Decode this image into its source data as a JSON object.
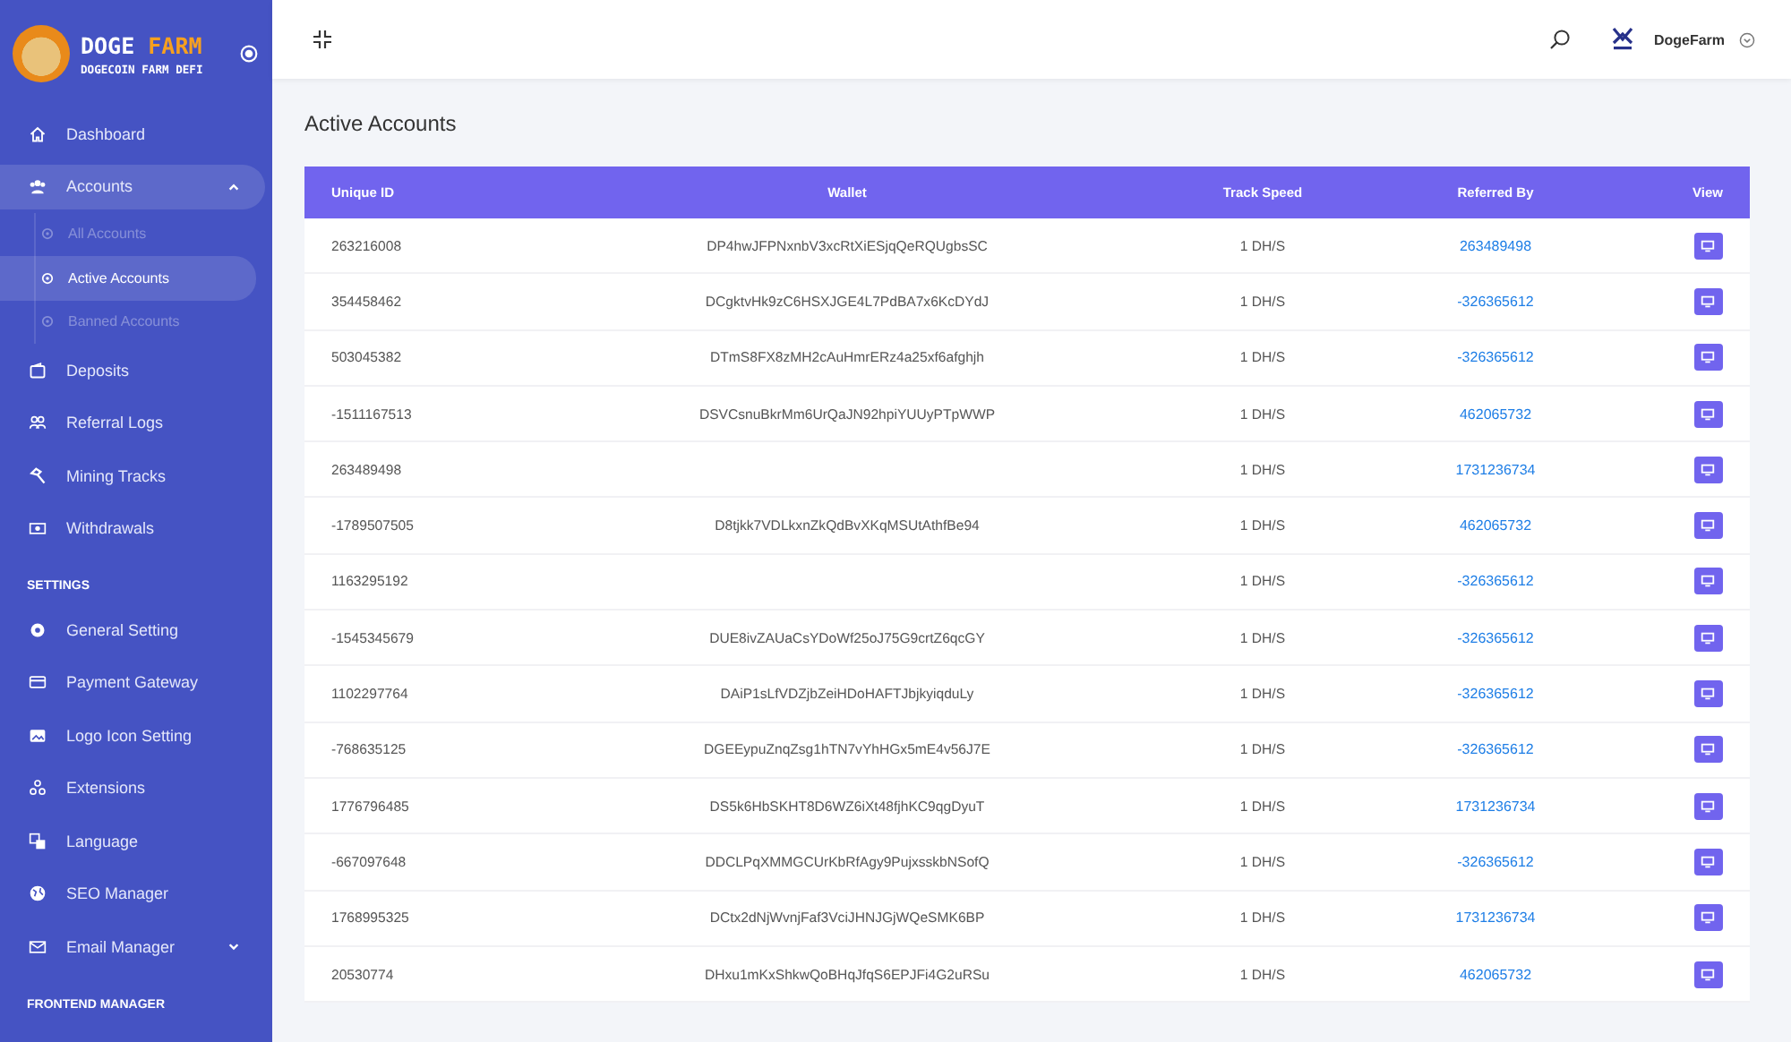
{
  "sidebar": {
    "brand": {
      "words": [
        "DOGE",
        "FARM"
      ],
      "tagline": "DOGECOIN FARM DEFI"
    },
    "sections": [
      {
        "items": [
          {
            "label": "Dashboard",
            "selected": false
          },
          {
            "label": "Accounts",
            "selected": false,
            "expanded": true,
            "children": [
              {
                "label": "All Accounts",
                "selected": false
              },
              {
                "label": "Active Accounts",
                "selected": true
              },
              {
                "label": "Banned Accounts",
                "selected": false
              }
            ]
          },
          {
            "label": "Deposits",
            "selected": false
          },
          {
            "label": "Referral Logs",
            "selected": false
          },
          {
            "label": "Mining Tracks",
            "selected": false
          },
          {
            "label": "Withdrawals",
            "selected": false
          }
        ]
      },
      {
        "heading": "SETTINGS",
        "items": [
          {
            "label": "General Setting",
            "selected": false
          },
          {
            "label": "Payment Gateway",
            "selected": false
          },
          {
            "label": "Logo Icon Setting",
            "selected": false
          },
          {
            "label": "Extensions",
            "selected": false
          },
          {
            "label": "Language",
            "selected": false
          },
          {
            "label": "SEO Manager",
            "selected": false
          },
          {
            "label": "Email Manager",
            "selected": false,
            "expanded": false
          }
        ]
      },
      {
        "heading": "FRONTEND MANAGER"
      }
    ]
  },
  "header": {
    "user": "DogeFarm"
  },
  "page_title": "Active Accounts",
  "table": {
    "columns": [
      "Unique ID",
      "Wallet",
      "Track Speed",
      "Referred By",
      "View"
    ],
    "rows": [
      {
        "id": "263216008",
        "wallet": "DP4hwJFPNxnbV3xcRtXiESjqQeRQUgbsSC",
        "speed": "1 DH/S",
        "referred_by": "263489498"
      },
      {
        "id": "354458462",
        "wallet": "DCgktvHk9zC6HSXJGE4L7PdBA7x6KcDYdJ",
        "speed": "1 DH/S",
        "referred_by": "-326365612"
      },
      {
        "id": "503045382",
        "wallet": "DTmS8FX8zMH2cAuHmrERz4a25xf6afghjh",
        "speed": "1 DH/S",
        "referred_by": "-326365612"
      },
      {
        "id": "-1511167513",
        "wallet": "DSVCsnuBkrMm6UrQaJN92hpiYUUyPTpWWP",
        "speed": "1 DH/S",
        "referred_by": "462065732"
      },
      {
        "id": "263489498",
        "speed": "1 DH/S",
        "referred_by": "1731236734"
      },
      {
        "id": "-1789507505",
        "wallet": "D8tjkk7VDLkxnZkQdBvXKqMSUtAthfBe94",
        "speed": "1 DH/S",
        "referred_by": "462065732"
      },
      {
        "id": "1163295192",
        "speed": "1 DH/S",
        "referred_by": "-326365612"
      },
      {
        "id": "-1545345679",
        "wallet": "DUE8ivZAUaCsYDoWf25oJ75G9crtZ6qcGY",
        "speed": "1 DH/S",
        "referred_by": "-326365612"
      },
      {
        "id": "1102297764",
        "wallet": "DAiP1sLfVDZjbZeiHDoHAFTJbjkyiqduLy",
        "speed": "1 DH/S",
        "referred_by": "-326365612"
      },
      {
        "id": "-768635125",
        "wallet": "DGEEypuZnqZsg1hTN7vYhHGx5mE4v56J7E",
        "speed": "1 DH/S",
        "referred_by": "-326365612"
      },
      {
        "id": "1776796485",
        "wallet": "DS5k6HbSKHT8D6WZ6iXt48fjhKC9qgDyuT",
        "speed": "1 DH/S",
        "referred_by": "1731236734"
      },
      {
        "id": "-667097648",
        "wallet": "DDCLPqXMMGCUrKbRfAgy9PujxsskbNSofQ",
        "speed": "1 DH/S",
        "referred_by": "-326365612"
      },
      {
        "id": "1768995325",
        "wallet": "DCtx2dNjWvnjFaf3VciJHNJGjWQeSMK6BP",
        "speed": "1 DH/S",
        "referred_by": "1731236734"
      },
      {
        "id": "20530774",
        "wallet": "DHxu1mKxShkwQoBHqJfqS6EPJFi4G2uRSu",
        "speed": "1 DH/S",
        "referred_by": "462065732"
      }
    ]
  }
}
